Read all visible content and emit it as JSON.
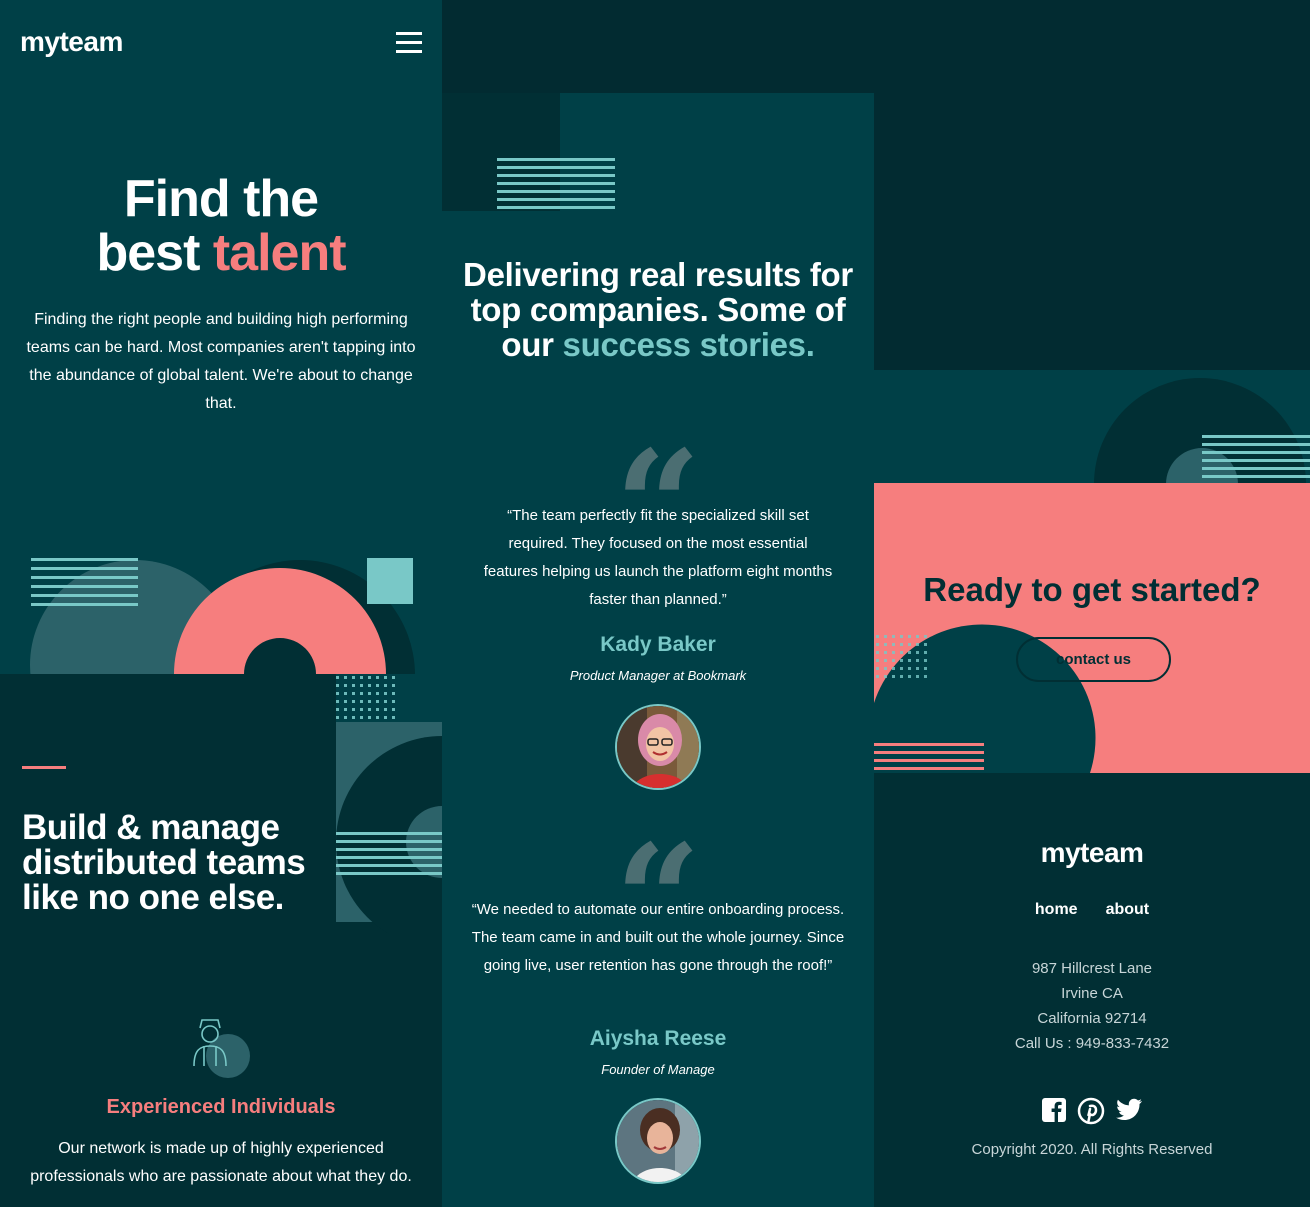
{
  "header": {
    "logo": "myteam",
    "menu_icon": "hamburger-icon"
  },
  "hero": {
    "title_line1": "Find the",
    "title_line2_white": "best ",
    "title_line2_accent": "talent",
    "text": "Finding the right people and building high performing teams can be hard. Most companies aren't tapping into the abundance of global talent. We're about to change that."
  },
  "features": {
    "title": "Build & manage distributed teams like no one else.",
    "item1": {
      "icon": "person-icon",
      "title": "Experienced Individuals",
      "text": "Our network is made up of highly experienced professionals who are passionate about what they do."
    }
  },
  "testimonials": {
    "title_white": "Delivering real results for top companies. Some of our ",
    "title_accent": "success stories.",
    "items": [
      {
        "quote": "“The team perfectly fit the specialized skill set required. They focused on the most essential features helping us launch the platform eight months faster than planned.”",
        "name": "Kady Baker",
        "role": "Product Manager at Bookmark",
        "avatar": "avatar-kady"
      },
      {
        "quote": "“We needed to automate our entire onboarding process. The team came in and built out the whole journey. Since going live, user retention has gone through the roof!”",
        "name": "Aiysha Reese",
        "role": "Founder of Manage",
        "avatar": "avatar-aiysha"
      }
    ]
  },
  "cta": {
    "title": "Ready to get started?",
    "button": "contact us"
  },
  "footer": {
    "logo": "myteam",
    "nav": [
      "home",
      "about"
    ],
    "address": [
      "987 Hillcrest Lane",
      "Irvine CA",
      "California 92714",
      "Call Us : 949-833-7432"
    ],
    "socials": [
      "facebook-icon",
      "pinterest-icon",
      "twitter-icon"
    ],
    "copyright": "Copyright 2020. All Rights Reserved"
  },
  "colors": {
    "dark_teal": "#004047",
    "darkest": "#012f34",
    "coral": "#f67e7e",
    "light_teal": "#79c8c7",
    "mid_teal": "#2c6269"
  }
}
